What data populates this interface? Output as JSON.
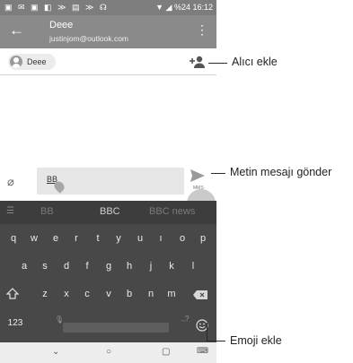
{
  "status_bar": {
    "left_icons": "▣ ✉ ▣ ◧ ≫ ▤ ≫ ☊",
    "time": "16:12",
    "battery": "%24"
  },
  "app_bar": {
    "back": "←",
    "contact_name": "Deee",
    "contact_email": "justinjom@outlook.com",
    "more": "⋮"
  },
  "recipients": {
    "chip_label": "Deee"
  },
  "compose": {
    "text": "BB",
    "send_sublabel": "MMS"
  },
  "keyboard": {
    "suggestions": [
      "BB",
      "BBC",
      "BBC news"
    ],
    "row1": [
      "q",
      "w",
      "e",
      "r",
      "t",
      "y",
      "u",
      "ı",
      "o",
      "p"
    ],
    "row2": [
      "a",
      "s",
      "d",
      "f",
      "g",
      "h",
      "j",
      "k",
      "l"
    ],
    "row3": [
      "z",
      "x",
      "c",
      "v",
      "b",
      "n",
      "m"
    ],
    "symbols_key": "123"
  },
  "navbar": {
    "back": "⌄",
    "home": "○",
    "recents": "▢"
  },
  "callouts": {
    "add_recipient": "Alıcı ekle",
    "send_message": "Metin mesajı gönder",
    "add_emoji": "Emoji ekle"
  },
  "colors": {
    "app_bar": "#8a8a8a",
    "status_bar": "#7d7d7d",
    "keyboard": "#484848"
  }
}
